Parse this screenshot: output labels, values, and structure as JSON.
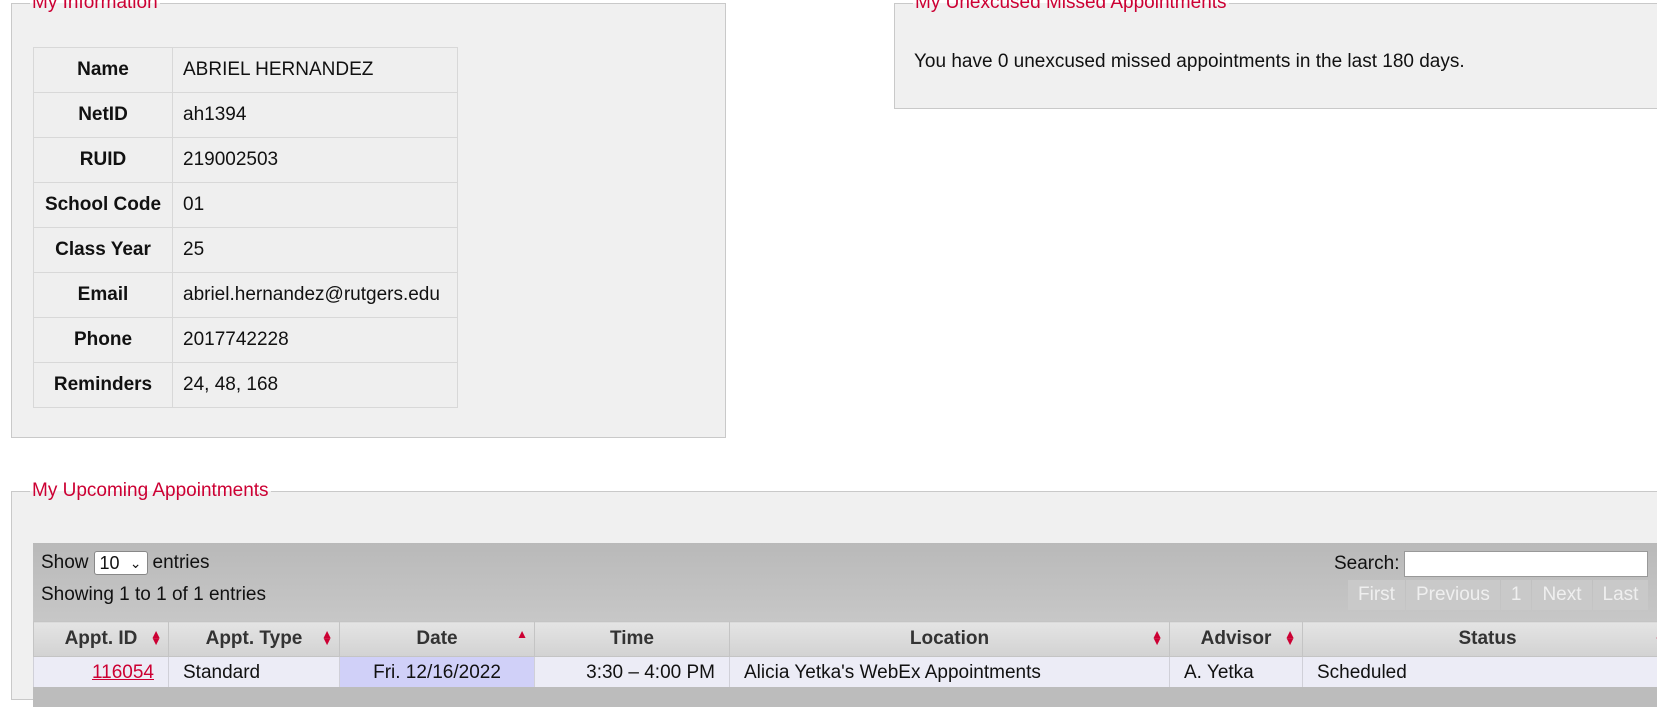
{
  "info": {
    "legend": "My Information",
    "rows": [
      {
        "label": "Name",
        "value": "ABRIEL HERNANDEZ"
      },
      {
        "label": "NetID",
        "value": "ah1394"
      },
      {
        "label": "RUID",
        "value": "219002503"
      },
      {
        "label": "School Code",
        "value": "01"
      },
      {
        "label": "Class Year",
        "value": "25"
      },
      {
        "label": "Email",
        "value": "abriel.hernandez@rutgers.edu"
      },
      {
        "label": "Phone",
        "value": "2017742228"
      },
      {
        "label": "Reminders",
        "value": "24, 48, 168"
      }
    ]
  },
  "missed": {
    "legend": "My Unexcused Missed Appointments",
    "text": "You have 0 unexcused missed appointments in the last 180 days."
  },
  "upcoming": {
    "legend": "My Upcoming Appointments",
    "show_label": "Show",
    "entries_value": "10",
    "entries_label": "entries",
    "showing_text": "Showing 1 to 1 of 1 entries",
    "search_label": "Search:",
    "search_value": "",
    "pager": [
      "First",
      "Previous",
      "1",
      "Next",
      "Last"
    ],
    "columns": [
      "Appt. ID",
      "Appt. Type",
      "Date",
      "Time",
      "Location",
      "Advisor",
      "Status"
    ],
    "rows": [
      {
        "id": "116054",
        "type": "Standard",
        "date": "Fri. 12/16/2022",
        "time": "3:30 – 4:00 PM",
        "location": "Alicia Yetka's WebEx Appointments",
        "advisor": "A. Yetka",
        "status": "Scheduled"
      }
    ]
  },
  "colors": {
    "accent": "#cc0033",
    "panel": "#f0f0f0",
    "sorted_cell": "#d0d0f8"
  }
}
